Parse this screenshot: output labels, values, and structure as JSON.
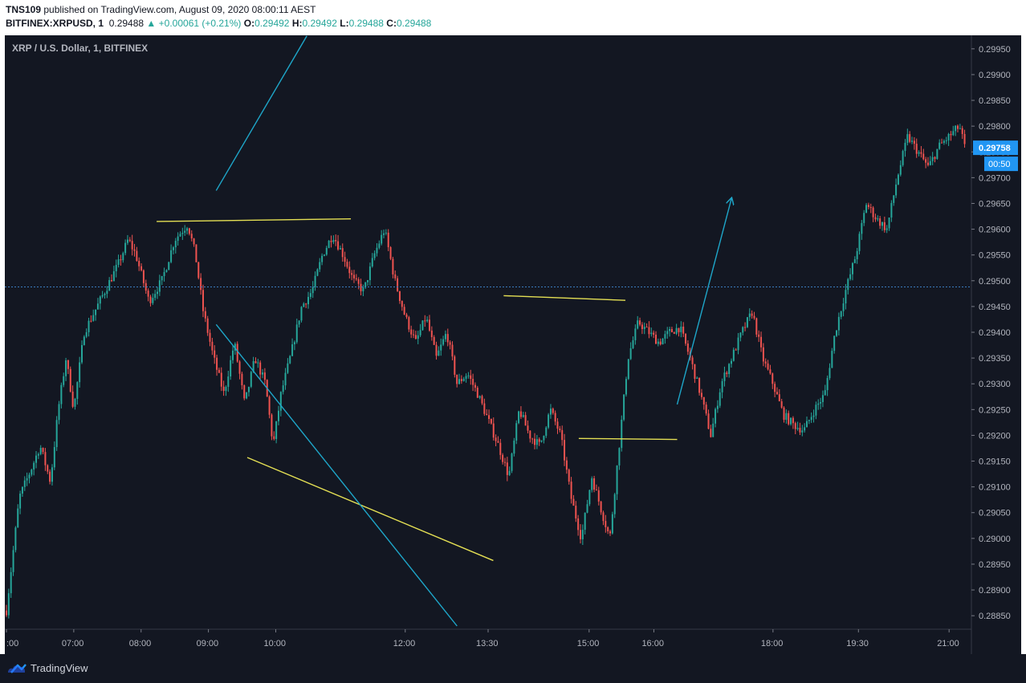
{
  "header": {
    "author": "TNS109",
    "published_text": "published on TradingView.com, August 09, 2020 08:00:11 AEST",
    "symbol": "BITFINEX:XRPUSD, 1",
    "last": "0.29488",
    "change": "+0.00061 (+0.21%)",
    "o_label": "O:",
    "o_value": "0.29492",
    "h_label": "H:",
    "h_value": "0.29492",
    "l_label": "L:",
    "l_value": "0.29488",
    "c_label": "C:",
    "c_value": "0.29488"
  },
  "footer": {
    "brand": "TradingView"
  },
  "colors": {
    "background": "#131722",
    "up": "#26a69a",
    "down": "#ef5350",
    "trendline_yellow": "#e5e054",
    "trendline_cyan": "#1ea6c9",
    "price_label": "#2196f3",
    "price_line": "#3a7bbf"
  },
  "chart_data": {
    "type": "candlestick",
    "title": "XRP / U.S. Dollar, 1, BITFINEX",
    "x_ticks": [
      ":00",
      "07:00",
      "08:00",
      "09:00",
      "10:00",
      "12:00",
      "13:30",
      "15:00",
      "16:00",
      "18:00",
      "19:30",
      "21:00"
    ],
    "y_ticks": [
      "0.29950",
      "0.29900",
      "0.29850",
      "0.29800",
      "0.29750",
      "0.29700",
      "0.29650",
      "0.29600",
      "0.29550",
      "0.29500",
      "0.29450",
      "0.29400",
      "0.29350",
      "0.29300",
      "0.29250",
      "0.29200",
      "0.29150",
      "0.29100",
      "0.29050",
      "0.29000",
      "0.28950",
      "0.28900",
      "0.28850"
    ],
    "ylim": [
      0.2883,
      0.2997
    ],
    "current_price_label": "0.29758",
    "countdown_label": "00:50",
    "horizontal_price_line": 0.29488,
    "price_path": [
      {
        "t": 0.0,
        "p": 0.2886
      },
      {
        "t": 0.5,
        "p": 0.2908
      },
      {
        "t": 1.0,
        "p": 0.2914
      },
      {
        "t": 1.3,
        "p": 0.2918
      },
      {
        "t": 1.7,
        "p": 0.2911
      },
      {
        "t": 2.0,
        "p": 0.2925
      },
      {
        "t": 2.3,
        "p": 0.2935
      },
      {
        "t": 2.6,
        "p": 0.2925
      },
      {
        "t": 3.0,
        "p": 0.294
      },
      {
        "t": 3.4,
        "p": 0.2944
      },
      {
        "t": 3.8,
        "p": 0.2948
      },
      {
        "t": 4.3,
        "p": 0.2953
      },
      {
        "t": 4.7,
        "p": 0.2958
      },
      {
        "t": 5.0,
        "p": 0.2955
      },
      {
        "t": 5.5,
        "p": 0.2946
      },
      {
        "t": 6.0,
        "p": 0.295
      },
      {
        "t": 6.5,
        "p": 0.2958
      },
      {
        "t": 7.0,
        "p": 0.2961
      },
      {
        "t": 7.3,
        "p": 0.2955
      },
      {
        "t": 7.6,
        "p": 0.2944
      },
      {
        "t": 8.0,
        "p": 0.2935
      },
      {
        "t": 8.4,
        "p": 0.2928
      },
      {
        "t": 8.8,
        "p": 0.2938
      },
      {
        "t": 9.2,
        "p": 0.2926
      },
      {
        "t": 9.6,
        "p": 0.2935
      },
      {
        "t": 10.0,
        "p": 0.293
      },
      {
        "t": 10.3,
        "p": 0.2918
      },
      {
        "t": 10.6,
        "p": 0.2928
      },
      {
        "t": 11.0,
        "p": 0.2936
      },
      {
        "t": 11.4,
        "p": 0.2945
      },
      {
        "t": 11.8,
        "p": 0.2948
      },
      {
        "t": 12.2,
        "p": 0.2955
      },
      {
        "t": 12.6,
        "p": 0.2959
      },
      {
        "t": 13.0,
        "p": 0.2955
      },
      {
        "t": 13.4,
        "p": 0.295
      },
      {
        "t": 13.8,
        "p": 0.2948
      },
      {
        "t": 14.2,
        "p": 0.2955
      },
      {
        "t": 14.6,
        "p": 0.296
      },
      {
        "t": 15.0,
        "p": 0.295
      },
      {
        "t": 15.4,
        "p": 0.2943
      },
      {
        "t": 15.8,
        "p": 0.2938
      },
      {
        "t": 16.2,
        "p": 0.2943
      },
      {
        "t": 16.6,
        "p": 0.2935
      },
      {
        "t": 17.0,
        "p": 0.294
      },
      {
        "t": 17.4,
        "p": 0.293
      },
      {
        "t": 17.8,
        "p": 0.2932
      },
      {
        "t": 18.2,
        "p": 0.2928
      },
      {
        "t": 18.6,
        "p": 0.2923
      },
      {
        "t": 19.0,
        "p": 0.2918
      },
      {
        "t": 19.4,
        "p": 0.2912
      },
      {
        "t": 19.8,
        "p": 0.2925
      },
      {
        "t": 20.2,
        "p": 0.292
      },
      {
        "t": 20.6,
        "p": 0.2918
      },
      {
        "t": 21.0,
        "p": 0.2925
      },
      {
        "t": 21.4,
        "p": 0.292
      },
      {
        "t": 21.8,
        "p": 0.2908
      },
      {
        "t": 22.2,
        "p": 0.29
      },
      {
        "t": 22.6,
        "p": 0.2912
      },
      {
        "t": 23.0,
        "p": 0.2905
      },
      {
        "t": 23.3,
        "p": 0.29
      },
      {
        "t": 23.6,
        "p": 0.2915
      },
      {
        "t": 24.0,
        "p": 0.2935
      },
      {
        "t": 24.4,
        "p": 0.2942
      },
      {
        "t": 24.8,
        "p": 0.294
      },
      {
        "t": 25.2,
        "p": 0.2938
      },
      {
        "t": 25.6,
        "p": 0.294
      },
      {
        "t": 26.0,
        "p": 0.2941
      },
      {
        "t": 26.4,
        "p": 0.2935
      },
      {
        "t": 26.8,
        "p": 0.2928
      },
      {
        "t": 27.2,
        "p": 0.292
      },
      {
        "t": 27.6,
        "p": 0.293
      },
      {
        "t": 28.0,
        "p": 0.2935
      },
      {
        "t": 28.4,
        "p": 0.294
      },
      {
        "t": 28.8,
        "p": 0.2944
      },
      {
        "t": 29.2,
        "p": 0.2935
      },
      {
        "t": 29.6,
        "p": 0.293
      },
      {
        "t": 30.0,
        "p": 0.2924
      },
      {
        "t": 30.4,
        "p": 0.2922
      },
      {
        "t": 30.8,
        "p": 0.2921
      },
      {
        "t": 31.2,
        "p": 0.2925
      },
      {
        "t": 31.6,
        "p": 0.2928
      },
      {
        "t": 32.0,
        "p": 0.294
      },
      {
        "t": 32.4,
        "p": 0.2948
      },
      {
        "t": 32.8,
        "p": 0.2955
      },
      {
        "t": 33.2,
        "p": 0.2965
      },
      {
        "t": 33.6,
        "p": 0.2962
      },
      {
        "t": 34.0,
        "p": 0.296
      },
      {
        "t": 34.4,
        "p": 0.297
      },
      {
        "t": 34.8,
        "p": 0.2978
      },
      {
        "t": 35.2,
        "p": 0.2975
      },
      {
        "t": 35.6,
        "p": 0.2972
      },
      {
        "t": 36.0,
        "p": 0.2976
      },
      {
        "t": 36.4,
        "p": 0.2978
      },
      {
        "t": 36.8,
        "p": 0.298
      },
      {
        "t": 37.0,
        "p": 0.2976
      }
    ],
    "drawings": [
      {
        "name": "resistance-line-left",
        "color": "yellow",
        "t1": 5.8,
        "p1": 0.29615,
        "t2": 13.3,
        "p2": 0.2962
      },
      {
        "name": "support-line-falling",
        "color": "yellow",
        "t1": 9.3,
        "p1": 0.29157,
        "t2": 18.8,
        "p2": 0.28957
      },
      {
        "name": "resistance-line-right",
        "color": "yellow",
        "t1": 19.2,
        "p1": 0.29471,
        "t2": 23.9,
        "p2": 0.29462
      },
      {
        "name": "support-line-right",
        "color": "yellow",
        "t1": 22.1,
        "p1": 0.29194,
        "t2": 25.9,
        "p2": 0.29192
      },
      {
        "name": "trend-line-up-top",
        "color": "cyan",
        "t1": 8.1,
        "p1": 0.29675,
        "t2": 11.6,
        "p2": 0.29975
      },
      {
        "name": "trend-line-down",
        "color": "cyan",
        "t1": 8.1,
        "p1": 0.29415,
        "t2": 17.4,
        "p2": 0.2883
      },
      {
        "name": "arrow-up",
        "color": "cyan",
        "t1": 25.9,
        "p1": 0.2926,
        "t2": 28.0,
        "p2": 0.2966,
        "arrow": true
      }
    ]
  }
}
